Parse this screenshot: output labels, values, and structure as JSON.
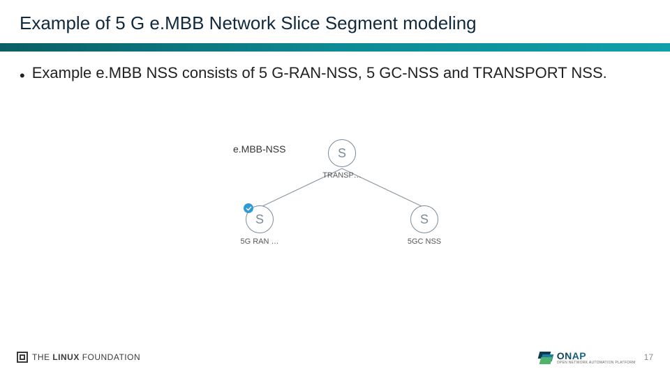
{
  "header": {
    "title": "Example of 5 G e.MBB Network Slice Segment modeling"
  },
  "body": {
    "bullet_marker": "•",
    "bullet_text": "Example e.MBB NSS consists of 5 G-RAN-NSS, 5 GC-NSS and TRANSPORT NSS."
  },
  "diagram": {
    "label": "e.MBB-NSS",
    "nodes": {
      "top": {
        "glyph": "S",
        "label": "TRANSP…"
      },
      "left": {
        "glyph": "S",
        "label": "5G RAN …",
        "checked": true
      },
      "right": {
        "glyph": "S",
        "label": "5GC NSS"
      }
    }
  },
  "footer": {
    "linux_foundation_prefix": "THE",
    "linux_foundation_strong": "LINUX",
    "linux_foundation_rest": "FOUNDATION",
    "onap_name": "ONAP",
    "onap_tag": "OPEN NETWORK AUTOMATION PLATFORM",
    "page_number": "17"
  },
  "colors": {
    "band": "#0d8a93",
    "node_stroke": "#7b8a97",
    "check": "#2e9bd6"
  }
}
